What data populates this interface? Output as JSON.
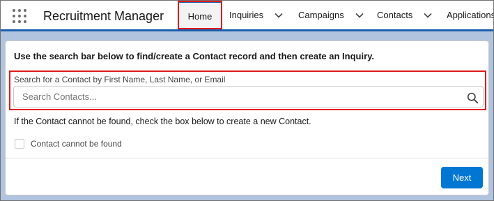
{
  "app": {
    "title": "Recruitment Manager",
    "launcher_icon": "app-launcher-grid-icon"
  },
  "nav": {
    "tabs": [
      {
        "label": "Home",
        "active": true
      },
      {
        "label": "Inquiries",
        "has_menu": true
      },
      {
        "label": "Campaigns",
        "has_menu": true
      },
      {
        "label": "Contacts",
        "has_menu": true
      },
      {
        "label": "Applications",
        "has_menu": false
      }
    ]
  },
  "card": {
    "heading": "Use the search bar below to find/create a Contact record and then create an Inquiry.",
    "search": {
      "label": "Search for a Contact by First Name, Last Name, or Email",
      "placeholder": "Search Contacts...",
      "value": "",
      "icon": "search-icon"
    },
    "help_text": "If the Contact cannot be found, check the box below to create a new Contact.",
    "checkbox": {
      "label": "Contact cannot be found",
      "checked": false
    },
    "next_label": "Next"
  },
  "colors": {
    "brand": "#1b5fae",
    "highlight": "#e01b1b",
    "button": "#0176d3",
    "background": "#b0c4df"
  }
}
